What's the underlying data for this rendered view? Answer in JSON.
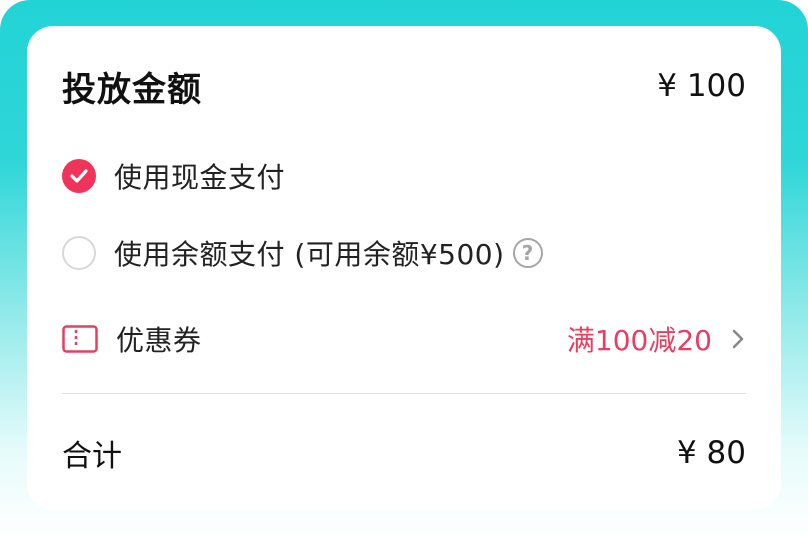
{
  "header": {
    "title": "投放金额",
    "amount": "¥ 100"
  },
  "payment_options": [
    {
      "label": "使用现金支付",
      "selected": true
    },
    {
      "label": "使用余额支付 (可用余额¥500)",
      "selected": false,
      "help_icon": "question-circle-icon"
    }
  ],
  "coupon": {
    "label": "优惠券",
    "value": "满100减20",
    "icon": "coupon-ticket-icon"
  },
  "total": {
    "label": "合计",
    "value": "¥ 80"
  },
  "colors": {
    "accent": "#f0335a",
    "coupon_text": "#ea3d62",
    "frame": "#22d3d6"
  }
}
